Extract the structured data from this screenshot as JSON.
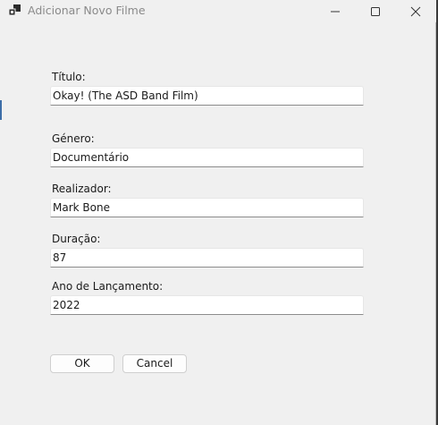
{
  "window": {
    "title": "Adicionar Novo Filme",
    "icon": "app-window-icon",
    "controls": [
      "minimize-icon",
      "maximize-icon",
      "close-icon"
    ]
  },
  "form": {
    "fields": [
      {
        "label": "Título:",
        "value": "Okay! (The ASD Band Film)"
      },
      {
        "label": "Género:",
        "value": "Documentário"
      },
      {
        "label": "Realizador:",
        "value": "Mark Bone"
      },
      {
        "label": "Duração:",
        "value": "87"
      },
      {
        "label": "Ano de Lançamento:",
        "value": "2022"
      }
    ]
  },
  "buttons": {
    "ok": "OK",
    "cancel": "Cancel"
  }
}
